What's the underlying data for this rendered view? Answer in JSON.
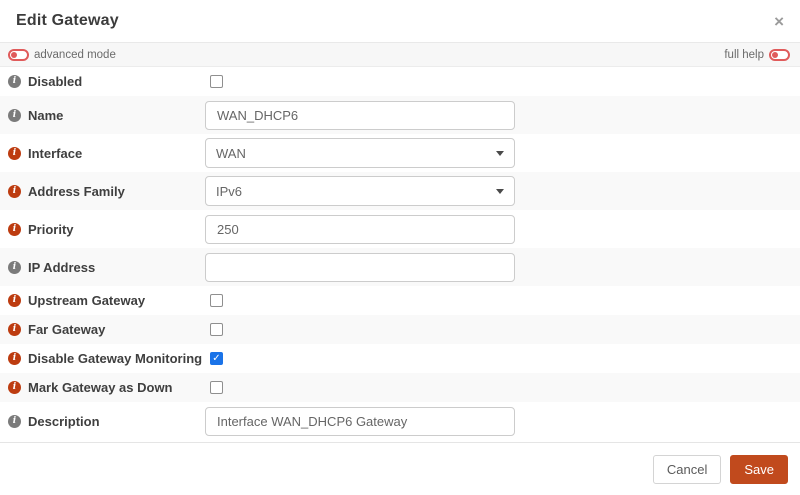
{
  "colors": {
    "accent": "#c14a1d",
    "info_red": "#bd3c10",
    "toggle_red": "#e05b5b",
    "checkbox_blue": "#1a73e8"
  },
  "icons": {
    "close_glyph": "×",
    "info_glyph": "i",
    "check_glyph": "✓"
  },
  "dialog": {
    "title": "Edit Gateway"
  },
  "help_bar": {
    "advanced_label": "advanced mode",
    "full_help_label": "full help"
  },
  "form": {
    "rows": [
      {
        "label": "Disabled",
        "icon": "gray",
        "type": "checkbox",
        "state": ""
      },
      {
        "label": "Name",
        "icon": "gray",
        "type": "text",
        "value": "WAN_DHCP6"
      },
      {
        "label": "Interface",
        "icon": "red",
        "type": "select",
        "value": "WAN"
      },
      {
        "label": "Address Family",
        "icon": "red",
        "type": "select",
        "value": "IPv6"
      },
      {
        "label": "Priority",
        "icon": "red",
        "type": "text",
        "value": "250"
      },
      {
        "label": "IP Address",
        "icon": "gray",
        "type": "text",
        "value": ""
      },
      {
        "label": "Upstream Gateway",
        "icon": "red",
        "type": "checkbox",
        "state": ""
      },
      {
        "label": "Far Gateway",
        "icon": "red",
        "type": "checkbox",
        "state": ""
      },
      {
        "label": "Disable Gateway Monitoring",
        "icon": "red",
        "type": "checkbox",
        "state": "checked"
      },
      {
        "label": "Mark Gateway as Down",
        "icon": "red",
        "type": "checkbox",
        "state": ""
      },
      {
        "label": "Description",
        "icon": "gray",
        "type": "text",
        "value": "Interface WAN_DHCP6 Gateway"
      }
    ]
  },
  "footer": {
    "cancel_label": "Cancel",
    "save_label": "Save"
  }
}
